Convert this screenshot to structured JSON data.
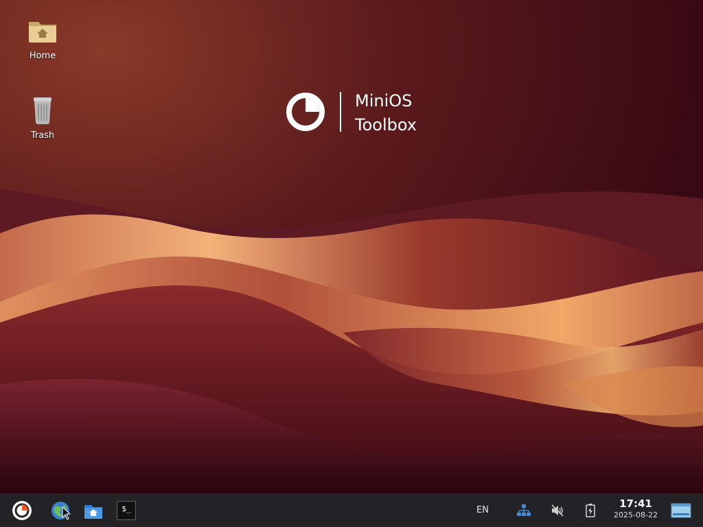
{
  "desktop": {
    "icons": [
      {
        "label": "Home",
        "icon": "home-folder-icon"
      },
      {
        "label": "Trash",
        "icon": "trash-icon"
      }
    ]
  },
  "brand": {
    "line1": "MiniOS",
    "line2": "Toolbox",
    "logo": "minios-logo-icon"
  },
  "taskbar": {
    "launchers": [
      {
        "name": "menu",
        "icon": "minios-logo-icon"
      },
      {
        "name": "browser",
        "icon": "globe-icon"
      },
      {
        "name": "file-manager",
        "icon": "folder-home-icon"
      },
      {
        "name": "terminal",
        "icon": "terminal-icon",
        "glyph": "$_"
      }
    ],
    "tray": {
      "language": "EN",
      "network_icon": "network-icon",
      "volume_icon": "volume-muted-icon",
      "battery_icon": "battery-charging-icon",
      "time": "17:41",
      "date": "2025-08-22",
      "show_desktop_icon": "show-desktop-icon"
    }
  },
  "colors": {
    "taskbar_bg": "#232327",
    "wallpaper_dark": "#3a0a14",
    "wallpaper_light": "#f0a060",
    "accent_orange": "#f05a22",
    "folder_blue": "#3d8ee0"
  }
}
